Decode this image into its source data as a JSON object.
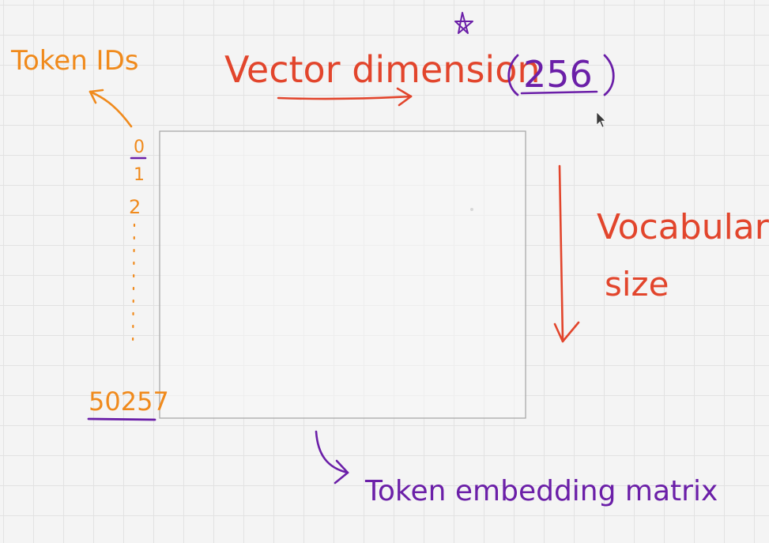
{
  "labels": {
    "token_ids": "Token IDs",
    "vector_dimension": "Vector dimension",
    "dimension_value": "256",
    "vocabulary_line1": "Vocabulary",
    "vocabulary_line2": "size",
    "matrix_caption": "Token embedding matrix"
  },
  "token_index": {
    "first": "0",
    "second": "1",
    "third": "2",
    "last": "50257"
  },
  "colors": {
    "orange": "#f08a1c",
    "red": "#e2452c",
    "purple": "#6b1fa8",
    "matrix_border": "#a9a9a9",
    "grid": "#e2e2e2"
  }
}
